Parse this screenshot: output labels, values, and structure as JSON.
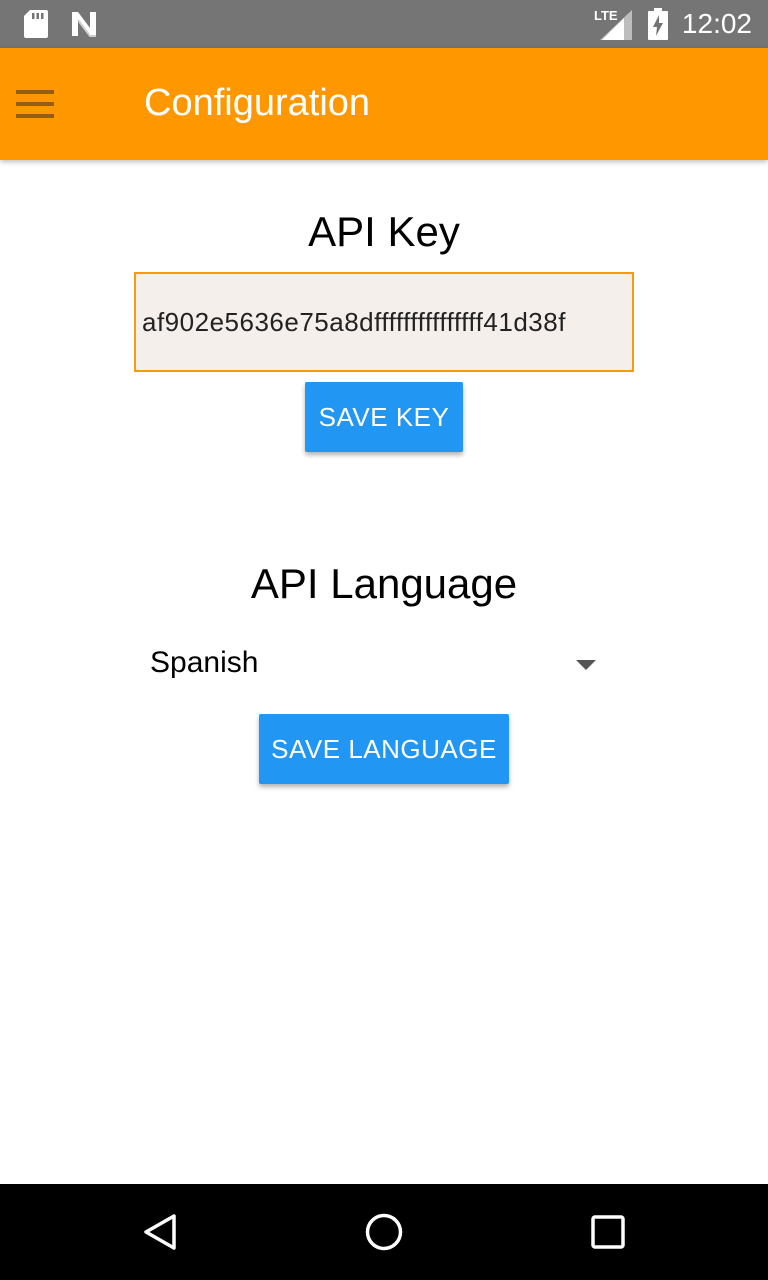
{
  "status_bar": {
    "time": "12:02",
    "network_label": "LTE",
    "icons": [
      "sd-card-icon",
      "n-notification-icon",
      "lte-signal-icon",
      "battery-charging-icon"
    ]
  },
  "app_bar": {
    "title": "Configuration",
    "menu_icon": "hamburger-menu-icon",
    "color": "#FF9800"
  },
  "api_key": {
    "title": "API Key",
    "value": "af902e5636e75a8dfffffffffffffff41d38f",
    "save_label": "SAVE KEY"
  },
  "api_language": {
    "title": "API Language",
    "selected": "Spanish",
    "save_label": "SAVE LANGUAGE"
  },
  "nav_bar": {
    "buttons": [
      "back-icon",
      "home-icon",
      "recents-icon"
    ]
  },
  "colors": {
    "accent": "#2196F3",
    "input_border": "#F39C12"
  }
}
